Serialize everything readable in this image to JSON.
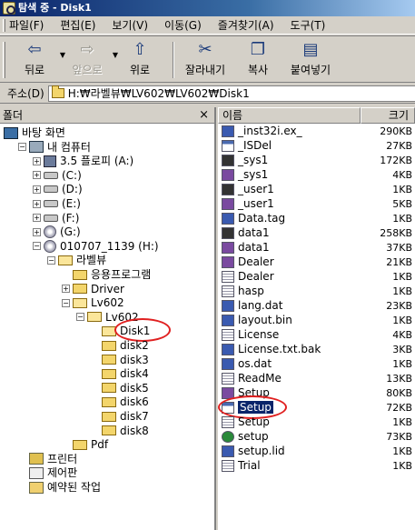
{
  "window": {
    "title": "탐색 중 - Disk1"
  },
  "menu": [
    "파일(F)",
    "편집(E)",
    "보기(V)",
    "이동(G)",
    "즐겨찾기(A)",
    "도구(T)"
  ],
  "toolbar": {
    "back": "뒤로",
    "forward": "앞으로",
    "up": "위로",
    "cut": "잘라내기",
    "copy": "복사",
    "paste": "붙여넣기"
  },
  "address": {
    "label": "주소(D)",
    "value": "H:₩라벨뷰₩LV602₩LV602₩Disk1"
  },
  "folders_pane": {
    "title": "폴더",
    "close": "×"
  },
  "tree": [
    {
      "label": "바탕 화면",
      "icon": "desktop-icon"
    },
    {
      "label": "내 컴퓨터",
      "icon": "computer-icon",
      "toggle": "−"
    },
    {
      "label": "3.5 플로피 (A:)",
      "icon": "floppy-icon",
      "toggle": "+"
    },
    {
      "label": "(C:)",
      "icon": "drive-icon",
      "toggle": "+"
    },
    {
      "label": "(D:)",
      "icon": "drive-icon",
      "toggle": "+"
    },
    {
      "label": "(E:)",
      "icon": "drive-icon",
      "toggle": "+"
    },
    {
      "label": "(F:)",
      "icon": "drive-icon",
      "toggle": "+"
    },
    {
      "label": "(G:)",
      "icon": "cdrom-icon",
      "toggle": "+"
    },
    {
      "label": "010707_1139 (H:)",
      "icon": "cdrom-icon",
      "toggle": "−"
    },
    {
      "label": "라벨뷰",
      "icon": "folder-open-icon",
      "toggle": "−"
    },
    {
      "label": "응용프로그램",
      "icon": "folder-icon"
    },
    {
      "label": "Driver",
      "icon": "folder-icon",
      "toggle": "+"
    },
    {
      "label": "Lv602",
      "icon": "folder-open-icon",
      "toggle": "−"
    },
    {
      "label": "Lv602",
      "icon": "folder-open-icon",
      "toggle": "−"
    },
    {
      "label": "Disk1",
      "icon": "folder-open-icon",
      "selected": true
    },
    {
      "label": "disk2",
      "icon": "folder-icon"
    },
    {
      "label": "disk3",
      "icon": "folder-icon"
    },
    {
      "label": "disk4",
      "icon": "folder-icon"
    },
    {
      "label": "disk5",
      "icon": "folder-icon"
    },
    {
      "label": "disk6",
      "icon": "folder-icon"
    },
    {
      "label": "disk7",
      "icon": "folder-icon"
    },
    {
      "label": "disk8",
      "icon": "folder-icon"
    },
    {
      "label": "Pdf",
      "icon": "folder-icon"
    },
    {
      "label": "프린터",
      "icon": "printer-icon"
    },
    {
      "label": "제어판",
      "icon": "control-panel-icon"
    },
    {
      "label": "예약된 작업",
      "icon": "scheduled-tasks-icon"
    }
  ],
  "list": {
    "col_name": "이름",
    "col_size": "크기",
    "files": [
      {
        "name": "_inst32i.ex_",
        "size": "290KB",
        "icon": "inst"
      },
      {
        "name": "_ISDel",
        "size": "27KB",
        "icon": "ex"
      },
      {
        "name": "_sys1",
        "size": "172KB",
        "icon": "cab"
      },
      {
        "name": "_sys1",
        "size": "4KB",
        "icon": "com"
      },
      {
        "name": "_user1",
        "size": "1KB",
        "icon": "cab"
      },
      {
        "name": "_user1",
        "size": "5KB",
        "icon": "com"
      },
      {
        "name": "Data.tag",
        "size": "1KB",
        "icon": "inst"
      },
      {
        "name": "data1",
        "size": "258KB",
        "icon": "cab"
      },
      {
        "name": "data1",
        "size": "37KB",
        "icon": "com"
      },
      {
        "name": "Dealer",
        "size": "21KB",
        "icon": "com"
      },
      {
        "name": "Dealer",
        "size": "1KB",
        "icon": "txt"
      },
      {
        "name": "hasp",
        "size": "1KB",
        "icon": "txt"
      },
      {
        "name": "lang.dat",
        "size": "23KB",
        "icon": "inst"
      },
      {
        "name": "layout.bin",
        "size": "1KB",
        "icon": "inst"
      },
      {
        "name": "License",
        "size": "4KB",
        "icon": "txt"
      },
      {
        "name": "License.txt.bak",
        "size": "3KB",
        "icon": "inst"
      },
      {
        "name": "os.dat",
        "size": "1KB",
        "icon": "inst"
      },
      {
        "name": "ReadMe",
        "size": "13KB",
        "icon": "txt"
      },
      {
        "name": "Setup",
        "size": "80KB",
        "icon": "com"
      },
      {
        "name": "Setup",
        "size": "72KB",
        "icon": "ex",
        "selected": true
      },
      {
        "name": "Setup",
        "size": "1KB",
        "icon": "txt"
      },
      {
        "name": "setup",
        "size": "73KB",
        "icon": "setup"
      },
      {
        "name": "setup.lid",
        "size": "1KB",
        "icon": "inst"
      },
      {
        "name": "Trial",
        "size": "1KB",
        "icon": "txt"
      }
    ]
  }
}
